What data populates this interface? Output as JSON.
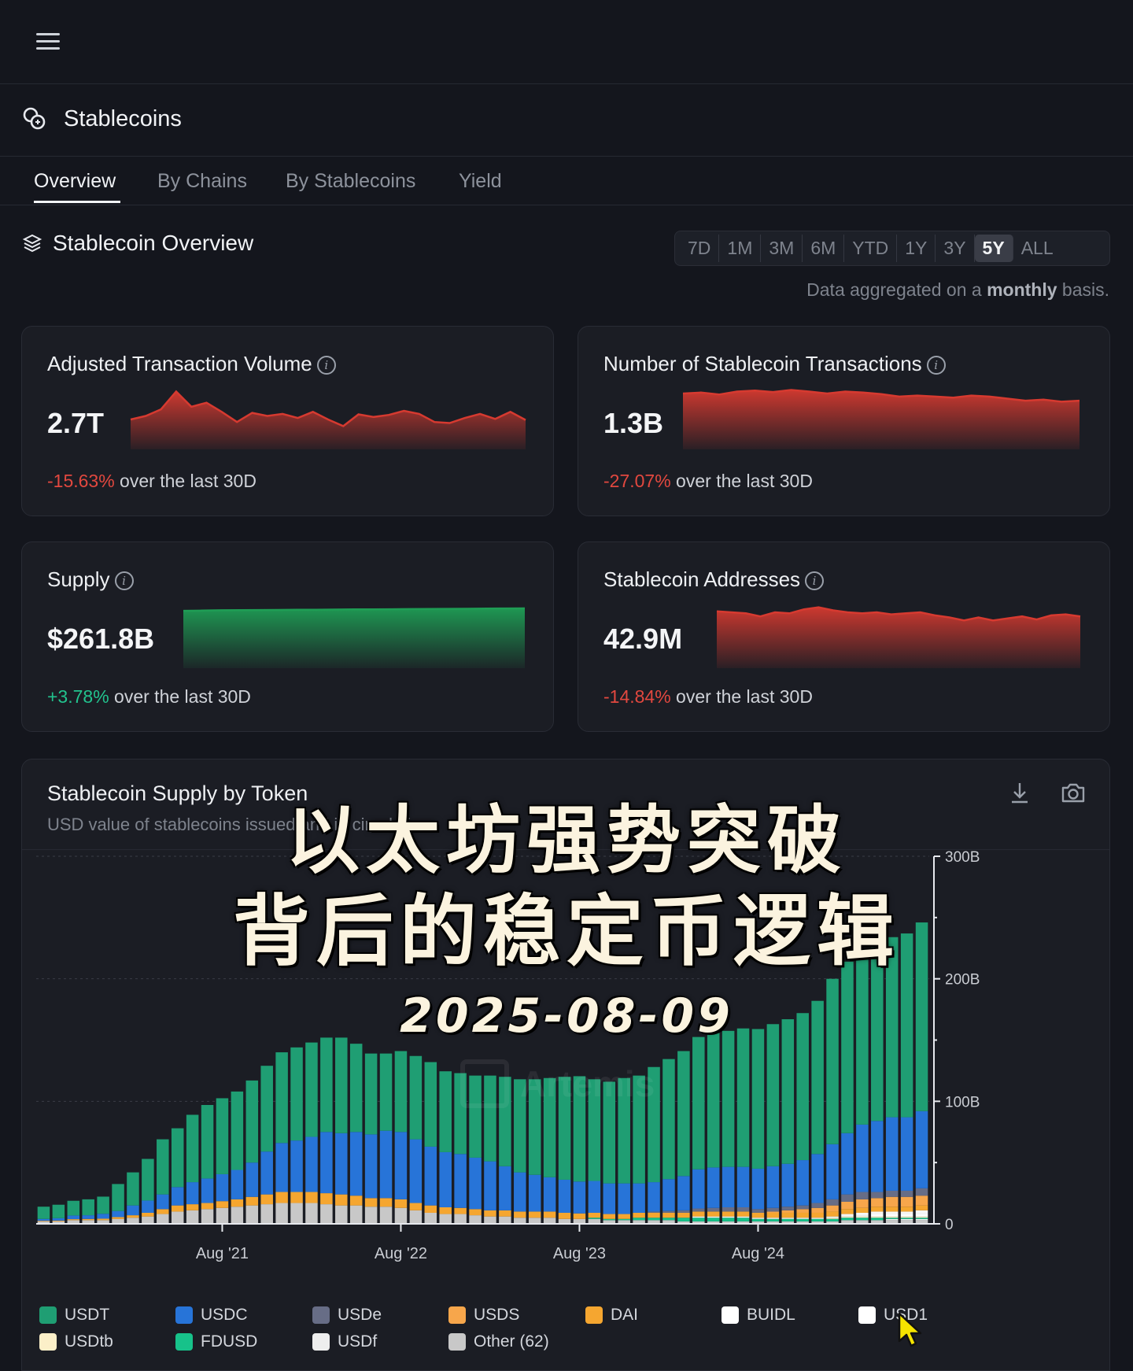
{
  "app": {
    "section_title": "Stablecoins",
    "tabs": [
      "Overview",
      "By Chains",
      "By Stablecoins",
      "Yield"
    ],
    "active_tab": "Overview"
  },
  "overview": {
    "title": "Stablecoin Overview",
    "ranges": [
      "7D",
      "1M",
      "3M",
      "6M",
      "YTD",
      "1Y",
      "3Y",
      "5Y",
      "ALL"
    ],
    "active_range": "5Y",
    "note_prefix": "Data aggregated on a ",
    "note_bold": "monthly",
    "note_suffix": " basis."
  },
  "metrics": [
    {
      "title": "Adjusted Transaction Volume",
      "value": "2.7T",
      "change": "-15.63%",
      "change_suffix": " over the last 30D",
      "trend": "negative",
      "color": "#d63a30",
      "spark": [
        0.35,
        0.42,
        0.55,
        0.9,
        0.6,
        0.68,
        0.5,
        0.3,
        0.48,
        0.42,
        0.46,
        0.38,
        0.5,
        0.35,
        0.22,
        0.45,
        0.4,
        0.44,
        0.52,
        0.46,
        0.3,
        0.28,
        0.38,
        0.46,
        0.36,
        0.5,
        0.34
      ]
    },
    {
      "title": "Number of Stablecoin Transactions",
      "value": "1.3B",
      "change": "-27.07%",
      "change_suffix": " over the last 30D",
      "trend": "negative",
      "color": "#d63a30",
      "spark": [
        0.86,
        0.88,
        0.84,
        0.9,
        0.92,
        0.89,
        0.93,
        0.9,
        0.86,
        0.9,
        0.88,
        0.85,
        0.8,
        0.82,
        0.8,
        0.78,
        0.82,
        0.8,
        0.76,
        0.72,
        0.74,
        0.7,
        0.72
      ]
    },
    {
      "title": "Supply",
      "value": "$261.8B",
      "change": "+3.78%",
      "change_suffix": " over the last 30D",
      "trend": "positive",
      "color": "#1f9d55",
      "spark": [
        0.95,
        0.955,
        0.96,
        0.962,
        0.965,
        0.968,
        0.97,
        0.972,
        0.975,
        0.978,
        0.98,
        0.982,
        0.985,
        0.988,
        0.99,
        0.992,
        0.995,
        0.998,
        1.0
      ]
    },
    {
      "title": "Stablecoin Addresses",
      "value": "42.9M",
      "change": "-14.84%",
      "change_suffix": " over the last 30D",
      "trend": "negative",
      "color": "#d63a30",
      "spark": [
        0.88,
        0.86,
        0.84,
        0.78,
        0.86,
        0.84,
        0.92,
        0.96,
        0.9,
        0.86,
        0.84,
        0.86,
        0.82,
        0.84,
        0.86,
        0.8,
        0.76,
        0.7,
        0.76,
        0.7,
        0.74,
        0.78,
        0.72,
        0.8,
        0.82,
        0.78
      ]
    }
  ],
  "info_glyph": "i",
  "chart_data": {
    "type": "bar",
    "stacked": true,
    "title": "Stablecoin Supply by Token",
    "subtitle": "USD value of stablecoins issued and in circulation",
    "ylim": [
      0,
      300
    ],
    "y_ticks": [
      "300B",
      "200B",
      "100B",
      "0"
    ],
    "y_tick_values": [
      300,
      200,
      100,
      0
    ],
    "x_ticks": [
      "Aug '21",
      "Aug '22",
      "Aug '23",
      "Aug '24"
    ],
    "x_tick_months": [
      "2021-08",
      "2022-08",
      "2023-08",
      "2024-08"
    ],
    "x": [
      "2020-08",
      "2020-09",
      "2020-10",
      "2020-11",
      "2020-12",
      "2021-01",
      "2021-02",
      "2021-03",
      "2021-04",
      "2021-05",
      "2021-06",
      "2021-07",
      "2021-08",
      "2021-09",
      "2021-10",
      "2021-11",
      "2021-12",
      "2022-01",
      "2022-02",
      "2022-03",
      "2022-04",
      "2022-05",
      "2022-06",
      "2022-07",
      "2022-08",
      "2022-09",
      "2022-10",
      "2022-11",
      "2022-12",
      "2023-01",
      "2023-02",
      "2023-03",
      "2023-04",
      "2023-05",
      "2023-06",
      "2023-07",
      "2023-08",
      "2023-09",
      "2023-10",
      "2023-11",
      "2023-12",
      "2024-01",
      "2024-02",
      "2024-03",
      "2024-04",
      "2024-05",
      "2024-06",
      "2024-07",
      "2024-08",
      "2024-09",
      "2024-10",
      "2024-11",
      "2024-12",
      "2025-01",
      "2025-02",
      "2025-03",
      "2025-04",
      "2025-05",
      "2025-06",
      "2025-07"
    ],
    "grid": true,
    "legend_position": "bottom",
    "series": [
      {
        "name": "Other (62)",
        "color": "#c8c8c8",
        "values": [
          2,
          2,
          3,
          3,
          3,
          4,
          5,
          6,
          8,
          10,
          11,
          12,
          13,
          14,
          15,
          16,
          17,
          17,
          17,
          16,
          15,
          15,
          14,
          14,
          13,
          11,
          9,
          8,
          8,
          7,
          6,
          6,
          5,
          5,
          5,
          4,
          4,
          4,
          3,
          3,
          3,
          3,
          3,
          2,
          2,
          2,
          2,
          2,
          2,
          2,
          2,
          2,
          2,
          2,
          3,
          3,
          3,
          3,
          3,
          3
        ]
      },
      {
        "name": "USDf",
        "color": "#eeeeee",
        "values": [
          0,
          0,
          0,
          0,
          0,
          0,
          0,
          0,
          0,
          0,
          0,
          0,
          0,
          0,
          0,
          0,
          0,
          0,
          0,
          0,
          0,
          0,
          0,
          0,
          0,
          0,
          0,
          0,
          0,
          0,
          0,
          0,
          0,
          0,
          0,
          0,
          0,
          0,
          0,
          0,
          0,
          0,
          0,
          0,
          0,
          0,
          0,
          0,
          0,
          0,
          0,
          0,
          0,
          0,
          0,
          0,
          0,
          1,
          1,
          1
        ]
      },
      {
        "name": "FDUSD",
        "color": "#17c28a",
        "values": [
          0,
          0,
          0,
          0,
          0,
          0,
          0,
          0,
          0,
          0,
          0,
          0,
          0,
          0,
          0,
          0,
          0,
          0,
          0,
          0,
          0,
          0,
          0,
          0,
          0,
          0,
          0,
          0,
          0,
          0,
          0,
          0,
          0,
          0,
          0,
          0,
          0,
          1,
          1,
          1,
          2,
          2,
          2,
          3,
          3,
          3,
          3,
          3,
          2,
          2,
          2,
          2,
          2,
          2,
          2,
          2,
          2,
          1,
          1,
          1
        ]
      },
      {
        "name": "USDtb",
        "color": "#fbefc8",
        "values": [
          0,
          0,
          0,
          0,
          0,
          0,
          0,
          0,
          0,
          0,
          0,
          0,
          0,
          0,
          0,
          0,
          0,
          0,
          0,
          0,
          0,
          0,
          0,
          0,
          0,
          0,
          0,
          0,
          0,
          0,
          0,
          0,
          0,
          0,
          0,
          0,
          0,
          0,
          0,
          0,
          0,
          0,
          0,
          0,
          0,
          0,
          0,
          0,
          0,
          0,
          0,
          0,
          0,
          1,
          1,
          1,
          1,
          1,
          1,
          1
        ]
      },
      {
        "name": "USD1",
        "color": "#ffffff",
        "values": [
          0,
          0,
          0,
          0,
          0,
          0,
          0,
          0,
          0,
          0,
          0,
          0,
          0,
          0,
          0,
          0,
          0,
          0,
          0,
          0,
          0,
          0,
          0,
          0,
          0,
          0,
          0,
          0,
          0,
          0,
          0,
          0,
          0,
          0,
          0,
          0,
          0,
          0,
          0,
          0,
          0,
          0,
          0,
          0,
          0,
          0,
          0,
          0,
          0,
          0,
          0,
          0,
          0,
          0,
          0,
          1,
          2,
          2,
          2,
          2
        ]
      },
      {
        "name": "BUIDL",
        "color": "#f7f7f7",
        "values": [
          0,
          0,
          0,
          0,
          0,
          0,
          0,
          0,
          0,
          0,
          0,
          0,
          0,
          0,
          0,
          0,
          0,
          0,
          0,
          0,
          0,
          0,
          0,
          0,
          0,
          0,
          0,
          0,
          0,
          0,
          0,
          0,
          0,
          0,
          0,
          0,
          0,
          0,
          0,
          0,
          0,
          0,
          0,
          0,
          1,
          1,
          1,
          1,
          1,
          1,
          1,
          1,
          1,
          1,
          2,
          2,
          2,
          2,
          2,
          3
        ]
      },
      {
        "name": "DAI",
        "color": "#f5a630",
        "values": [
          0.5,
          0.6,
          0.8,
          1,
          1.2,
          1.5,
          2,
          3,
          4,
          5,
          5,
          5,
          5.5,
          6,
          7,
          8,
          9,
          9,
          9,
          9,
          9,
          8,
          7,
          7,
          7,
          6,
          6,
          5.5,
          5,
          5,
          5,
          5,
          5,
          5,
          5,
          5,
          4.5,
          4,
          4,
          4,
          4,
          4,
          4,
          4,
          4,
          4,
          4,
          4,
          4,
          4,
          4,
          4,
          4,
          4,
          4,
          4,
          4,
          4,
          4,
          4
        ]
      },
      {
        "name": "USDS",
        "color": "#f7a64b",
        "values": [
          0,
          0,
          0,
          0,
          0,
          0,
          0,
          0,
          0,
          0,
          0,
          0,
          0,
          0,
          0,
          0,
          0,
          0,
          0,
          0,
          0,
          0,
          0,
          0,
          0,
          0,
          0,
          0,
          0,
          0,
          0,
          0,
          0,
          0,
          0,
          0,
          0,
          0,
          0,
          0,
          0,
          0,
          0,
          0,
          0,
          0,
          0,
          0,
          0,
          1,
          2,
          3,
          4,
          5,
          6,
          7,
          7,
          8,
          8,
          8
        ]
      },
      {
        "name": "USDe",
        "color": "#676d86",
        "values": [
          0,
          0,
          0,
          0,
          0,
          0,
          0,
          0,
          0,
          0,
          0,
          0,
          0,
          0,
          0,
          0,
          0,
          0,
          0,
          0,
          0,
          0,
          0,
          0,
          0,
          0,
          0,
          0,
          0,
          0,
          0,
          0,
          0,
          0,
          0,
          0,
          0,
          0,
          0,
          0,
          0,
          1,
          1.5,
          2,
          2.5,
          3,
          3.5,
          3.5,
          3,
          3,
          3,
          3,
          4,
          5,
          6,
          6,
          5,
          5,
          5,
          6
        ]
      },
      {
        "name": "USDC",
        "color": "#2774d8",
        "values": [
          1.5,
          2,
          3,
          3,
          4,
          5,
          8,
          10,
          12,
          15,
          18,
          20,
          22,
          24,
          28,
          35,
          40,
          42,
          45,
          50,
          50,
          52,
          52,
          55,
          55,
          52,
          48,
          45,
          44,
          42,
          40,
          36,
          32,
          30,
          28,
          27,
          26,
          26,
          25,
          25,
          24,
          24,
          26,
          28,
          32,
          33,
          33,
          33,
          33,
          34,
          35,
          37,
          40,
          45,
          50,
          55,
          58,
          60,
          60,
          63
        ]
      },
      {
        "name": "USDT",
        "color": "#1f9e73",
        "values": [
          10,
          11,
          12,
          13,
          14,
          22,
          27,
          34,
          45,
          48,
          55,
          60,
          62,
          64,
          67,
          70,
          74,
          76,
          77,
          77,
          78,
          72,
          66,
          63,
          66,
          68,
          69,
          66,
          66,
          67,
          70,
          73,
          76,
          78,
          81,
          84,
          86,
          83,
          83,
          86,
          88,
          94,
          98,
          102,
          108,
          110,
          111,
          113,
          114,
          116,
          118,
          120,
          125,
          135,
          140,
          142,
          144,
          147,
          150,
          154
        ]
      }
    ]
  },
  "legend_order": [
    "USDT",
    "USDC",
    "USDe",
    "USDS",
    "DAI",
    "BUIDL",
    "USD1",
    "USDtb",
    "FDUSD",
    "USDf",
    "Other (62)"
  ],
  "legend_colors": {
    "USDT": "#1f9e73",
    "USDC": "#2774d8",
    "USDe": "#676d86",
    "USDS": "#f7a64b",
    "DAI": "#f5a630",
    "BUIDL": "#ffffff",
    "USD1": "#ffffff",
    "USDtb": "#fbefc8",
    "FDUSD": "#17c28a",
    "USDf": "#eeeeee",
    "Other (62)": "#c8c8c8"
  },
  "watermark": "Artemis",
  "overlay": {
    "line1": "以太坊强势突破",
    "line2": "背后的稳定币逻辑",
    "date": "2025-08-09"
  },
  "icons": {
    "menu": "hamburger-icon",
    "section": "coins-icon",
    "overview": "layers-icon",
    "download": "download-icon",
    "camera": "camera-icon"
  },
  "colors": {
    "background": "#14161d",
    "card": "#1b1d24",
    "negative": "#e2483f",
    "positive": "#22c38e"
  }
}
